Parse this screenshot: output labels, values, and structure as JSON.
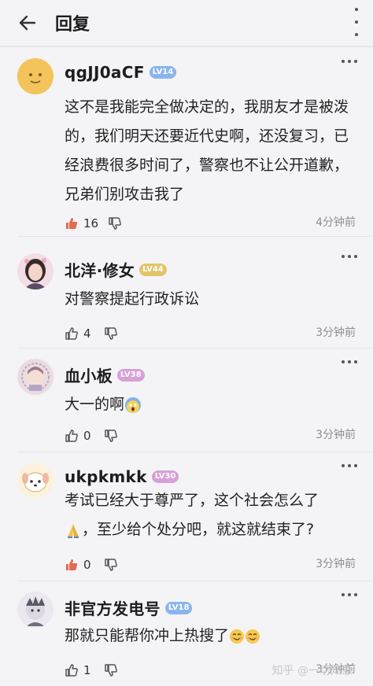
{
  "header": {
    "title": "回复"
  },
  "comments": [
    {
      "username": "qgJJ0aCF",
      "level": "LV14",
      "level_color": "#8ab4ee",
      "text": "这不是我能完全做决定的，我朋友才是被泼的，我们明天还要近代史啊，还没复习，已经浪费很多时间了，警察也不让公开道歉，兄弟们别攻击我了",
      "likes": "16",
      "liked": true,
      "time": "4分钟前"
    },
    {
      "username": "北洋·修女",
      "level": "LV44",
      "level_color": "#e3c46a",
      "text": "对警察提起行政诉讼",
      "likes": "4",
      "liked": false,
      "time": "3分钟前"
    },
    {
      "username": "血小板",
      "level": "LV38",
      "level_color": "#d7a0d8",
      "text": "大一的啊",
      "likes": "0",
      "liked": false,
      "time": "3分钟前"
    },
    {
      "username": "ukpkmkk",
      "level": "LV30",
      "level_color": "#d7a0d8",
      "text_line1": "考试已经大于尊严了，这个社会怎么了",
      "text_line2": "，至少给个处分吧，就这就结束了?",
      "likes": "0",
      "liked": true,
      "time": "3分钟前"
    },
    {
      "username": "非官方发电号",
      "level": "LV18",
      "level_color": "#8ab4ee",
      "text": "那就只能帮你冲上热搜了",
      "likes": "1",
      "liked": false,
      "time": "3分钟前"
    }
  ],
  "watermark": "知乎 @一切知意",
  "icons": {
    "back": "arrow-left-icon",
    "more": "more-dots-icon",
    "like": "thumbs-up-icon",
    "dislike": "thumbs-down-icon"
  },
  "colors": {
    "like_active": "#e26a4f",
    "icon_gray": "#555555"
  }
}
